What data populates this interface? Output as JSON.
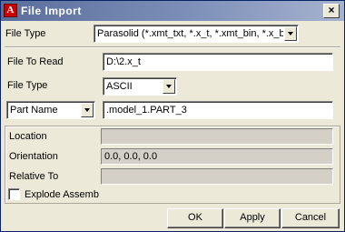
{
  "window": {
    "title": "File Import",
    "app_icon_letter": "A",
    "close_glyph": "×"
  },
  "file_type_top": {
    "label": "File Type",
    "value": "Parasolid (*.xmt_txt, *.x_t, *.xmt_bin, *.x_b"
  },
  "file_to_read": {
    "label": "File To Read",
    "value": "D:\\2.x_t"
  },
  "file_type_format": {
    "label": "File Type",
    "value": "ASCII"
  },
  "part_name": {
    "selector_value": "Part Name",
    "value": ".model_1.PART_3"
  },
  "location": {
    "label": "Location",
    "value": ""
  },
  "orientation": {
    "label": "Orientation",
    "value": "0.0, 0.0, 0.0"
  },
  "relative_to": {
    "label": "Relative To",
    "value": ""
  },
  "explode_assemblies": {
    "label": "Explode Assemb",
    "checked": false
  },
  "buttons": {
    "ok": "OK",
    "apply": "Apply",
    "cancel": "Cancel"
  }
}
